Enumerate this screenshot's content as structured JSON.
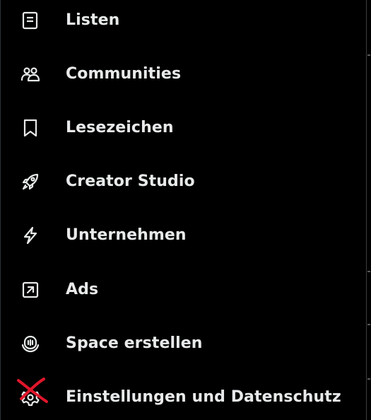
{
  "menu": {
    "items": [
      {
        "label": "Listen",
        "icon": "list-icon"
      },
      {
        "label": "Communities",
        "icon": "communities-icon"
      },
      {
        "label": "Lesezeichen",
        "icon": "bookmark-icon"
      },
      {
        "label": "Creator Studio",
        "icon": "rocket-icon"
      },
      {
        "label": "Unternehmen",
        "icon": "lightning-icon"
      },
      {
        "label": "Ads",
        "icon": "ads-arrow-icon"
      },
      {
        "label": "Space erstellen",
        "icon": "spaces-mic-icon"
      },
      {
        "label": "Einstellungen und Datenschutz",
        "icon": "gear-icon"
      }
    ]
  },
  "colors": {
    "background": "#000000",
    "text": "#e7e9ea",
    "annotation_red": "#e0162b"
  }
}
